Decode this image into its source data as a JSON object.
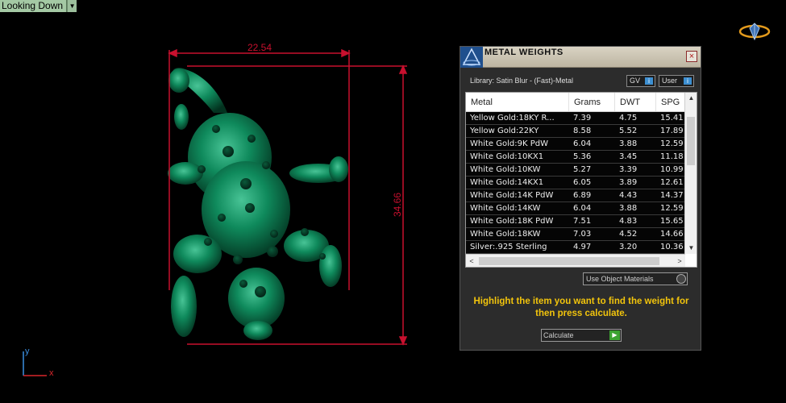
{
  "viewport": {
    "label": "Looking Down",
    "dropdown_icon": "chevron-down-icon"
  },
  "dimensions": {
    "width": "22.54",
    "height": "34.66",
    "line_color": "#c8102e"
  },
  "axis": {
    "y": "y",
    "x": "x"
  },
  "dialog": {
    "title": "METAL WEIGHTS",
    "close_icon": "×",
    "library_label": "Library: Satin Blur - (Fast)-Metal",
    "gv_label": "GV",
    "user_label": "User",
    "columns": [
      "Metal",
      "Grams",
      "DWT",
      "SPG"
    ],
    "rows": [
      {
        "metal": "Yellow Gold:18KY R...",
        "grams": "7.39",
        "dwt": "4.75",
        "spg": "15.41"
      },
      {
        "metal": "Yellow Gold:22KY",
        "grams": "8.58",
        "dwt": "5.52",
        "spg": "17.89"
      },
      {
        "metal": "White Gold:9K PdW",
        "grams": "6.04",
        "dwt": "3.88",
        "spg": "12.59"
      },
      {
        "metal": "White Gold:10KX1",
        "grams": "5.36",
        "dwt": "3.45",
        "spg": "11.18"
      },
      {
        "metal": "White Gold:10KW",
        "grams": "5.27",
        "dwt": "3.39",
        "spg": "10.99"
      },
      {
        "metal": "White Gold:14KX1",
        "grams": "6.05",
        "dwt": "3.89",
        "spg": "12.61"
      },
      {
        "metal": "White Gold:14K PdW",
        "grams": "6.89",
        "dwt": "4.43",
        "spg": "14.37"
      },
      {
        "metal": "White Gold:14KW",
        "grams": "6.04",
        "dwt": "3.88",
        "spg": "12.59"
      },
      {
        "metal": "White Gold:18K PdW",
        "grams": "7.51",
        "dwt": "4.83",
        "spg": "15.65"
      },
      {
        "metal": "White Gold:18KW",
        "grams": "7.03",
        "dwt": "4.52",
        "spg": "14.66"
      },
      {
        "metal": "Silver:.925 Sterling",
        "grams": "4.97",
        "dwt": "3.20",
        "spg": "10.36"
      }
    ],
    "use_object_materials": "Use Object Materials",
    "hint": "Highlight the item you want to find the weight for then press calculate.",
    "calculate_label": "Calculate"
  },
  "colors": {
    "model": "#0f7a52",
    "hint": "#f2c40c",
    "accent_blue": "#3d8fd1",
    "play_green": "#3ca331"
  }
}
